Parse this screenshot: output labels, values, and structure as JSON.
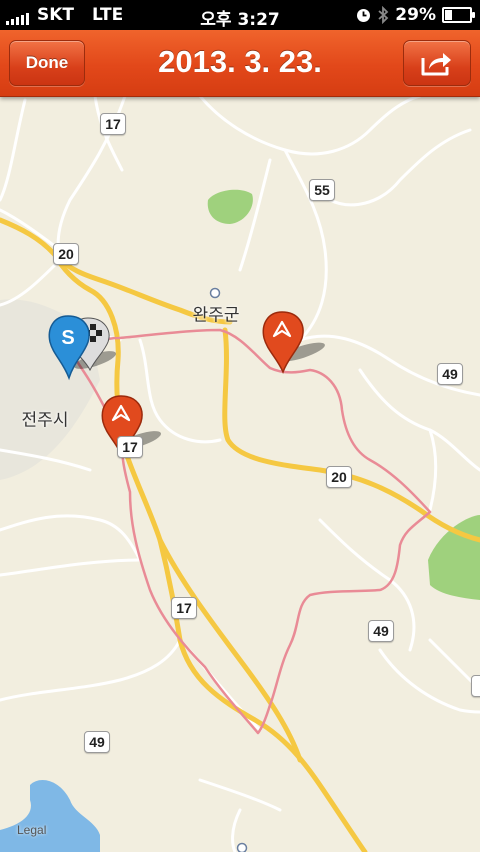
{
  "status_bar": {
    "carrier": "SKT",
    "network": "LTE",
    "time": "오후 3:27",
    "battery": "29%",
    "battery_level": 0.29,
    "icons": [
      "signal-bars-icon",
      "clock-icon",
      "bluetooth-icon",
      "battery-icon"
    ]
  },
  "nav": {
    "done_label": "Done",
    "title": "2013. 3. 23.",
    "share_icon": "share-arrow-icon"
  },
  "map": {
    "place_labels": {
      "wanju": "완주군",
      "jeonju": "전주시"
    },
    "road_shields": {
      "r17a": "17",
      "r17b": "17",
      "r17c": "17",
      "r20a": "20",
      "r20b": "20",
      "r55": "55",
      "r49a": "49",
      "r49b": "49",
      "r49c": "49",
      "r_edge": ""
    },
    "pins": {
      "start_letter": "S"
    },
    "legal_text": "Legal",
    "colors": {
      "land": "#f2eedf",
      "highway": "#f5c842",
      "route": "#e98b96",
      "park": "#9fd17d",
      "water": "#7fb8e6",
      "nav_bar": "#e2481a",
      "start_pin": "#2b8fd8",
      "waypoint_pin": "#e14a1e"
    }
  }
}
